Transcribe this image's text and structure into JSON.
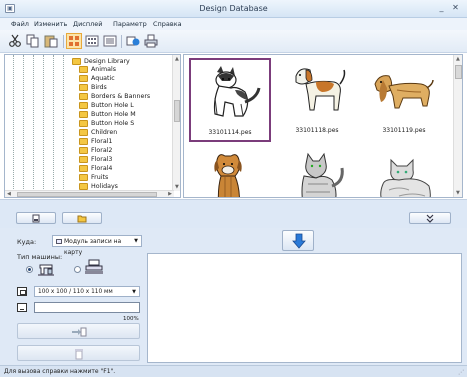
{
  "window": {
    "title": "Design Database",
    "icon": "app-icon",
    "minimize": "_",
    "close": "✕"
  },
  "menu": [
    "Файл",
    "Изменить",
    "Дисплей",
    "Параметр",
    "Справка"
  ],
  "toolbar": {
    "icons": [
      "cut-icon",
      "copy-icon",
      "paste-icon",
      "large-thumbnails-icon",
      "small-thumbnails-icon",
      "details-view-icon",
      "transfer-icon",
      "print-icon"
    ],
    "accent": "#e8a83a"
  },
  "tree": {
    "root": "Design Library",
    "items": [
      "Animals",
      "Aquatic",
      "Birds",
      "Borders & Banners",
      "Button Hole L",
      "Button Hole M",
      "Button Hole S",
      "Children",
      "Floral1",
      "Floral2",
      "Floral3",
      "Floral4",
      "Fruits",
      "Holidays"
    ]
  },
  "thumbnails": [
    {
      "label": "33101114.pes",
      "selected": true,
      "subject": "husky"
    },
    {
      "label": "33101118.pes",
      "selected": false,
      "subject": "beagle"
    },
    {
      "label": "33101119.pes",
      "selected": false,
      "subject": "cocker-spaniel"
    },
    {
      "label": "",
      "selected": false,
      "subject": "terrier"
    },
    {
      "label": "",
      "selected": false,
      "subject": "grey-cat"
    },
    {
      "label": "",
      "selected": false,
      "subject": "persian-cat"
    }
  ],
  "selection_color": "#7b3c7b",
  "transfer": {
    "dest_label": "Куда:",
    "dest_value": "Модуль записи на карту",
    "machine_type_label": "Тип машины:",
    "hoop_size": "100 x 100 / 110 x 110 мм",
    "progress_text": "100%",
    "progress_fraction": 0
  },
  "status": {
    "text": "Для вызова справки нажмите \"F1\"."
  }
}
